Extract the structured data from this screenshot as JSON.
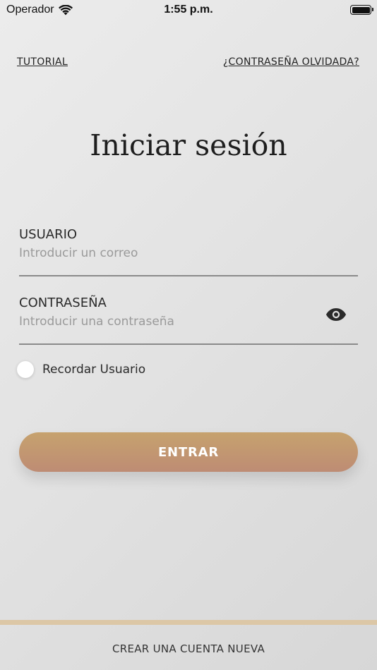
{
  "status_bar": {
    "carrier": "Operador",
    "time": "1:55 p.m.",
    "wifi_icon": "wifi-icon",
    "battery_icon": "battery-icon"
  },
  "links": {
    "tutorial": "TUTORIAL",
    "forgot_password": "¿CONTRASEÑA OLVIDADA?"
  },
  "title": "Iniciar sesión",
  "form": {
    "user": {
      "label": "USUARIO",
      "placeholder": "Introducir un correo",
      "value": ""
    },
    "password": {
      "label": "CONTRASEÑA",
      "placeholder": "Introducir una contraseña",
      "value": "",
      "toggle_icon": "eye-icon"
    },
    "remember": {
      "label": "Recordar Usuario",
      "checked": false
    },
    "submit_label": "ENTRAR"
  },
  "footer": {
    "create_account": "CREAR UNA CUENTA NUEVA"
  },
  "colors": {
    "button_top": "#c6a26e",
    "button_bottom": "#be8c74",
    "footer_line": "#dcc7a6"
  }
}
